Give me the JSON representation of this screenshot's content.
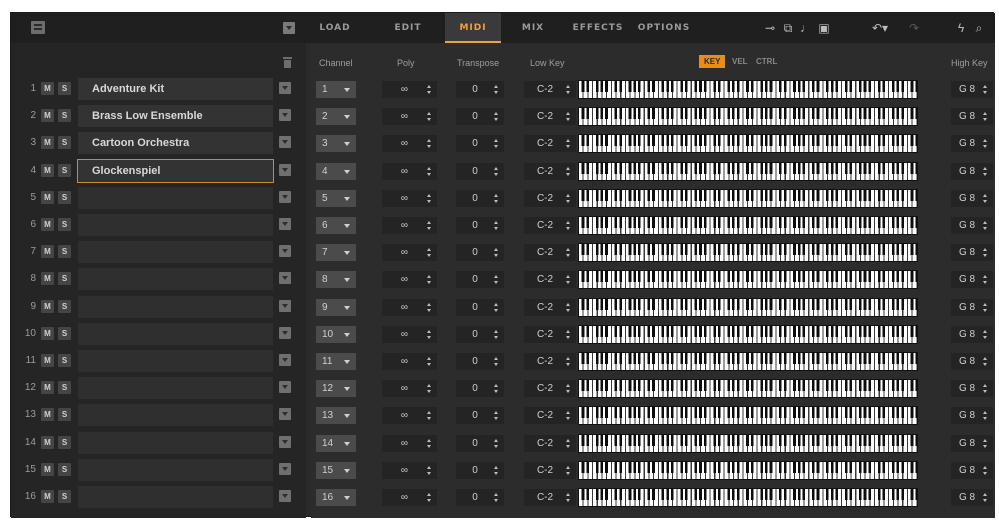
{
  "tabs": [
    "LOAD",
    "EDIT",
    "MIDI",
    "MIX",
    "EFFECTS",
    "OPTIONS"
  ],
  "active_tab": "MIDI",
  "accent_color": "#f3a03a",
  "toolbar_icons": [
    "midi-connect-icon",
    "copy-icon",
    "note-icon",
    "lock-icon",
    "undo-icon",
    "redo-icon",
    "bolt-icon",
    "search-icon"
  ],
  "headers": {
    "channel": "Channel",
    "poly": "Poly",
    "transpose": "Transpose",
    "low_key": "Low Key",
    "high_key": "High Key",
    "toggles": [
      "KEY",
      "VEL",
      "CTRL"
    ]
  },
  "slots": [
    {
      "num": "1",
      "m": "M",
      "s": "S",
      "name": "Adventure Kit",
      "channel": "1",
      "poly": "∞",
      "transpose": "0",
      "low": "C-2",
      "high": "G 8"
    },
    {
      "num": "2",
      "m": "M",
      "s": "S",
      "name": "Brass Low Ensemble",
      "channel": "2",
      "poly": "∞",
      "transpose": "0",
      "low": "C-2",
      "high": "G 8"
    },
    {
      "num": "3",
      "m": "M",
      "s": "S",
      "name": "Cartoon Orchestra",
      "channel": "3",
      "poly": "∞",
      "transpose": "0",
      "low": "C-2",
      "high": "G 8"
    },
    {
      "num": "4",
      "m": "M",
      "s": "S",
      "name": "Glockenspiel",
      "channel": "4",
      "poly": "∞",
      "transpose": "0",
      "low": "C-2",
      "high": "G 8"
    },
    {
      "num": "5",
      "m": "M",
      "s": "S",
      "name": "",
      "channel": "5",
      "poly": "∞",
      "transpose": "0",
      "low": "C-2",
      "high": "G 8"
    },
    {
      "num": "6",
      "m": "M",
      "s": "S",
      "name": "",
      "channel": "6",
      "poly": "∞",
      "transpose": "0",
      "low": "C-2",
      "high": "G 8"
    },
    {
      "num": "7",
      "m": "M",
      "s": "S",
      "name": "",
      "channel": "7",
      "poly": "∞",
      "transpose": "0",
      "low": "C-2",
      "high": "G 8"
    },
    {
      "num": "8",
      "m": "M",
      "s": "S",
      "name": "",
      "channel": "8",
      "poly": "∞",
      "transpose": "0",
      "low": "C-2",
      "high": "G 8"
    },
    {
      "num": "9",
      "m": "M",
      "s": "S",
      "name": "",
      "channel": "9",
      "poly": "∞",
      "transpose": "0",
      "low": "C-2",
      "high": "G 8"
    },
    {
      "num": "10",
      "m": "M",
      "s": "S",
      "name": "",
      "channel": "10",
      "poly": "∞",
      "transpose": "0",
      "low": "C-2",
      "high": "G 8"
    },
    {
      "num": "11",
      "m": "M",
      "s": "S",
      "name": "",
      "channel": "11",
      "poly": "∞",
      "transpose": "0",
      "low": "C-2",
      "high": "G 8"
    },
    {
      "num": "12",
      "m": "M",
      "s": "S",
      "name": "",
      "channel": "12",
      "poly": "∞",
      "transpose": "0",
      "low": "C-2",
      "high": "G 8"
    },
    {
      "num": "13",
      "m": "M",
      "s": "S",
      "name": "",
      "channel": "13",
      "poly": "∞",
      "transpose": "0",
      "low": "C-2",
      "high": "G 8"
    },
    {
      "num": "14",
      "m": "M",
      "s": "S",
      "name": "",
      "channel": "14",
      "poly": "∞",
      "transpose": "0",
      "low": "C-2",
      "high": "G 8"
    },
    {
      "num": "15",
      "m": "M",
      "s": "S",
      "name": "",
      "channel": "15",
      "poly": "∞",
      "transpose": "0",
      "low": "C-2",
      "high": "G 8"
    },
    {
      "num": "16",
      "m": "M",
      "s": "S",
      "name": "",
      "channel": "16",
      "poly": "∞",
      "transpose": "0",
      "low": "C-2",
      "high": "G 8"
    }
  ],
  "selected_slot": 4
}
